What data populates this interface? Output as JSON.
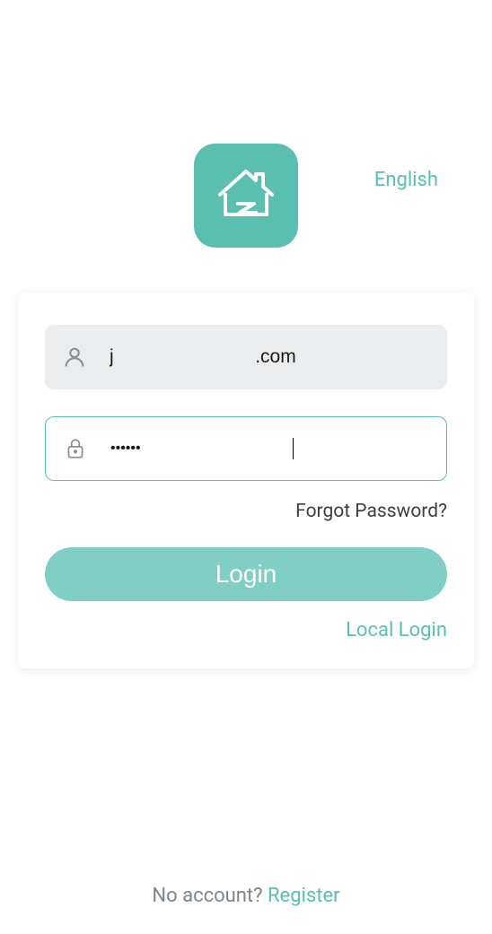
{
  "header": {
    "language": "English"
  },
  "logo": {
    "name": "app-house-logo"
  },
  "form": {
    "username": {
      "value": "j                           .com",
      "placeholder": ""
    },
    "password": {
      "value": "••••••",
      "placeholder": ""
    },
    "forgot_label": "Forgot Password?",
    "login_label": "Login",
    "local_login_label": "Local Login"
  },
  "footer": {
    "prompt": "No account?  ",
    "register_label": "Register"
  },
  "colors": {
    "accent": "#5bbfb0",
    "button": "#7fcfc4",
    "muted": "#7f8589",
    "input_bg": "#eaeced"
  }
}
